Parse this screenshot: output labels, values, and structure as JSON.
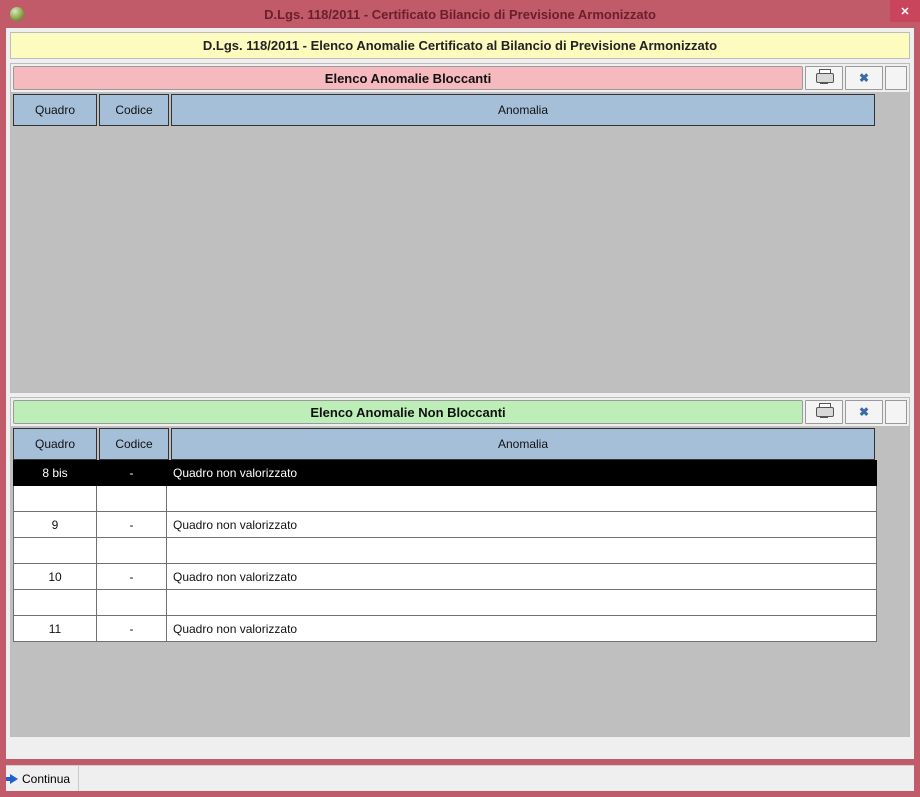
{
  "window": {
    "title": "D.Lgs. 118/2011 - Certificato Bilancio di Previsione Armonizzato"
  },
  "banner": "D.Lgs. 118/2011 - Elenco Anomalie Certificato al Bilancio di Previsione Armonizzato",
  "columns": {
    "quadro": "Quadro",
    "codice": "Codice",
    "anomalia": "Anomalia"
  },
  "section_blocking": {
    "title": "Elenco Anomalie Bloccanti",
    "rows": []
  },
  "section_nonblocking": {
    "title": "Elenco Anomalie Non Bloccanti",
    "rows": [
      {
        "quadro": "8 bis",
        "codice": "-",
        "anomalia": "Quadro non valorizzato",
        "selected": true
      },
      {
        "quadro": "",
        "codice": "",
        "anomalia": ""
      },
      {
        "quadro": "9",
        "codice": "-",
        "anomalia": "Quadro non valorizzato"
      },
      {
        "quadro": "",
        "codice": "",
        "anomalia": ""
      },
      {
        "quadro": "10",
        "codice": "-",
        "anomalia": "Quadro non valorizzato"
      },
      {
        "quadro": "",
        "codice": "",
        "anomalia": ""
      },
      {
        "quadro": "11",
        "codice": "-",
        "anomalia": "Quadro non valorizzato"
      }
    ]
  },
  "statusbar": {
    "continua": "Continua"
  }
}
